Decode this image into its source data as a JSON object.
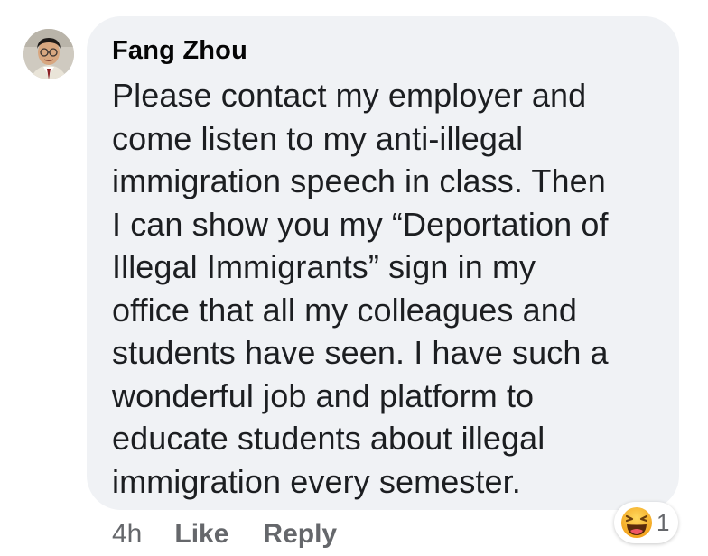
{
  "comment": {
    "author": "Fang Zhou",
    "text": "Please contact my employer and\ncome listen to my anti-illegal\nimmigration speech in class. Then\nI can show you my “Deportation of\nIllegal Immigrants” sign in my\noffice that all my colleagues and\nstudents have seen. I have such a\nwonderful job and platform to\neducate students about illegal\nimmigration every semester.",
    "time": "4h",
    "like_label": "Like",
    "reply_label": "Reply",
    "reaction": {
      "icon": "haha-emoji-icon",
      "count": "1"
    }
  },
  "colors": {
    "bubble_bg": "#f0f2f5",
    "meta_text": "#65676b",
    "reaction_yellow": "#f7b125"
  }
}
